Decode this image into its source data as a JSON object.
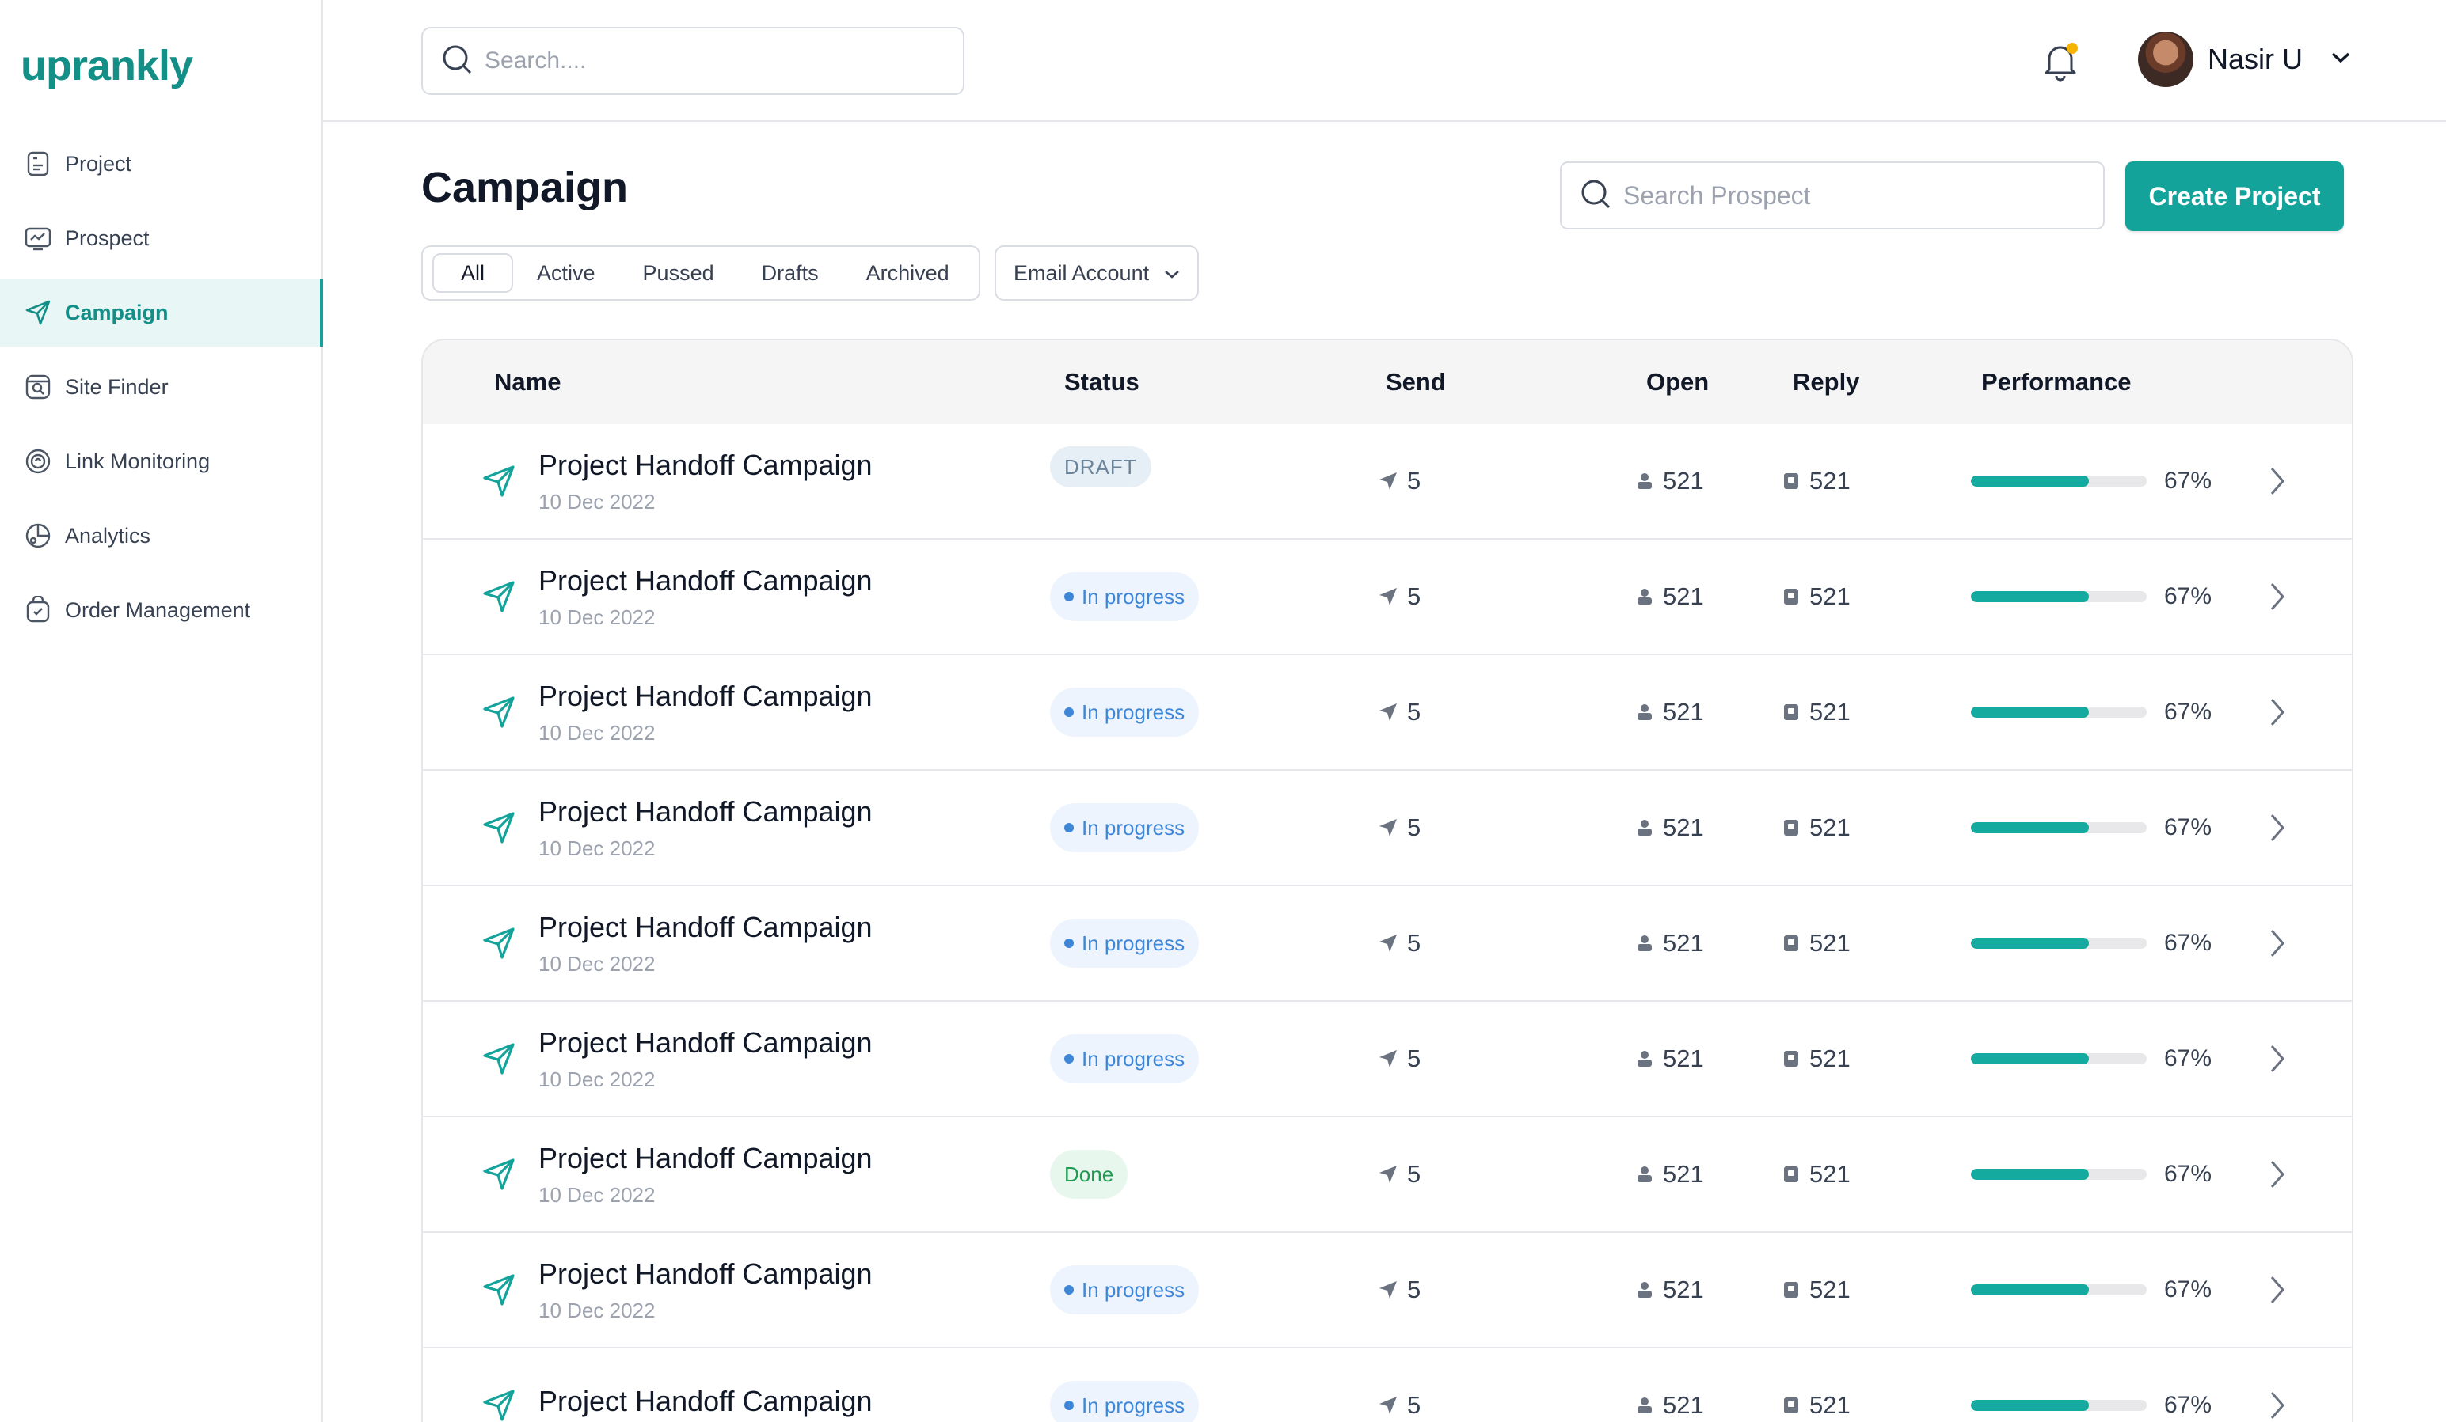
{
  "brand": {
    "logo_text": "uprankly"
  },
  "sidebar": {
    "items": [
      {
        "label": "Project",
        "icon": "document-icon",
        "active": false
      },
      {
        "label": "Prospect",
        "icon": "prospect-icon",
        "active": false
      },
      {
        "label": "Campaign",
        "icon": "send-icon",
        "active": true
      },
      {
        "label": "Site Finder",
        "icon": "site-finder-icon",
        "active": false
      },
      {
        "label": "Link Monitoring",
        "icon": "link-monitoring-icon",
        "active": false
      },
      {
        "label": "Analytics",
        "icon": "analytics-icon",
        "active": false
      },
      {
        "label": "Order Management",
        "icon": "order-icon",
        "active": false
      }
    ]
  },
  "topbar": {
    "search_placeholder": "Search....",
    "user_name": "Nasir U"
  },
  "page": {
    "title": "Campaign",
    "prospect_search_placeholder": "Search Prospect",
    "create_button": "Create Project",
    "tabs": [
      "All",
      "Active",
      "Pussed",
      "Drafts",
      "Archived"
    ],
    "active_tab": "All",
    "email_account_label": "Email Account"
  },
  "table": {
    "columns": [
      "Name",
      "Status",
      "Send",
      "Open",
      "Reply",
      "Performance"
    ],
    "rows": [
      {
        "name": "Project Handoff Campaign",
        "date": "10 Dec 2022",
        "status": "DRAFT",
        "status_type": "draft",
        "send": "5",
        "open": "521",
        "reply": "521",
        "performance_pct": 67,
        "performance_label": "67%"
      },
      {
        "name": "Project Handoff Campaign",
        "date": "10 Dec 2022",
        "status": "In progress",
        "status_type": "progress",
        "send": "5",
        "open": "521",
        "reply": "521",
        "performance_pct": 67,
        "performance_label": "67%"
      },
      {
        "name": "Project Handoff Campaign",
        "date": "10 Dec 2022",
        "status": "In progress",
        "status_type": "progress",
        "send": "5",
        "open": "521",
        "reply": "521",
        "performance_pct": 67,
        "performance_label": "67%"
      },
      {
        "name": "Project Handoff Campaign",
        "date": "10 Dec 2022",
        "status": "In progress",
        "status_type": "progress",
        "send": "5",
        "open": "521",
        "reply": "521",
        "performance_pct": 67,
        "performance_label": "67%"
      },
      {
        "name": "Project Handoff Campaign",
        "date": "10 Dec 2022",
        "status": "In progress",
        "status_type": "progress",
        "send": "5",
        "open": "521",
        "reply": "521",
        "performance_pct": 67,
        "performance_label": "67%"
      },
      {
        "name": "Project Handoff Campaign",
        "date": "10 Dec 2022",
        "status": "In progress",
        "status_type": "progress",
        "send": "5",
        "open": "521",
        "reply": "521",
        "performance_pct": 67,
        "performance_label": "67%"
      },
      {
        "name": "Project Handoff Campaign",
        "date": "10 Dec 2022",
        "status": "Done",
        "status_type": "done",
        "send": "5",
        "open": "521",
        "reply": "521",
        "performance_pct": 67,
        "performance_label": "67%"
      },
      {
        "name": "Project Handoff Campaign",
        "date": "10 Dec 2022",
        "status": "In progress",
        "status_type": "progress",
        "send": "5",
        "open": "521",
        "reply": "521",
        "performance_pct": 67,
        "performance_label": "67%"
      },
      {
        "name": "Project Handoff Campaign",
        "date": "",
        "status": "In progress",
        "status_type": "progress",
        "send": "5",
        "open": "521",
        "reply": "521",
        "performance_pct": 67,
        "performance_label": "67%"
      }
    ]
  },
  "colors": {
    "accent": "#14a39a",
    "progress_blue": "#3d86d8",
    "done_green": "#1f9a52",
    "notification_dot": "#f5b400"
  }
}
